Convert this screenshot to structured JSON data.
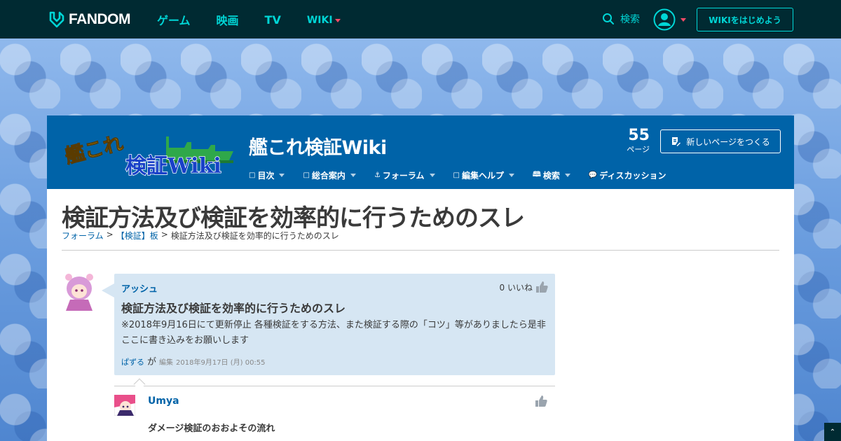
{
  "topnav": {
    "brand": "FANDOM",
    "links": [
      "ゲーム",
      "映画",
      "TV",
      "WIKI"
    ],
    "search_label": "検索",
    "start_wiki": "WIKIをはじめよう"
  },
  "wiki": {
    "logo_text_line1": "艦これ",
    "logo_text_line2": "検証Wiki",
    "name": "艦これ検証Wiki",
    "page_count": "55",
    "page_count_label": "ページ",
    "new_page_button": "新しいページをつくる",
    "nav": [
      {
        "label": "目次",
        "icon": "square-icon"
      },
      {
        "label": "総合案内",
        "icon": "square-icon"
      },
      {
        "label": "フォーラム",
        "icon": "anchor-icon"
      },
      {
        "label": "編集ヘルプ",
        "icon": "square-icon"
      },
      {
        "label": "検索",
        "icon": "book-icon"
      },
      {
        "label": "ディスカッション",
        "icon": "speech-bubble-icon"
      }
    ]
  },
  "page": {
    "title": "検証方法及び検証を効率的に行うためのスレ",
    "breadcrumb": {
      "forum": "フォーラム",
      "sep": ">",
      "board": "【検証】板",
      "current": "検証方法及び検証を効率的に行うためのスレ"
    }
  },
  "thread": {
    "author": "アッシュ",
    "likes": "0 いいね",
    "title": "検証方法及び検証を効率的に行うためのスレ",
    "body": "※2018年9月16日にて更新停止 各種検証をする方法、また検証する際の「コツ」等がありましたら是非ここに書き込みをお願いします",
    "editor": "ぱずる",
    "editor_suffix": "が",
    "edit_label": "編集",
    "timestamp": "2018年9月17日 (月) 00:55"
  },
  "reply": {
    "author": "Umya",
    "body": "ダメージ検証のおおよその流れ"
  },
  "colors": {
    "topnav_bg": "#002a32",
    "accent_teal": "#00d6d6",
    "wiki_header": "#0063a8",
    "post_bg": "#d6e6f3"
  }
}
